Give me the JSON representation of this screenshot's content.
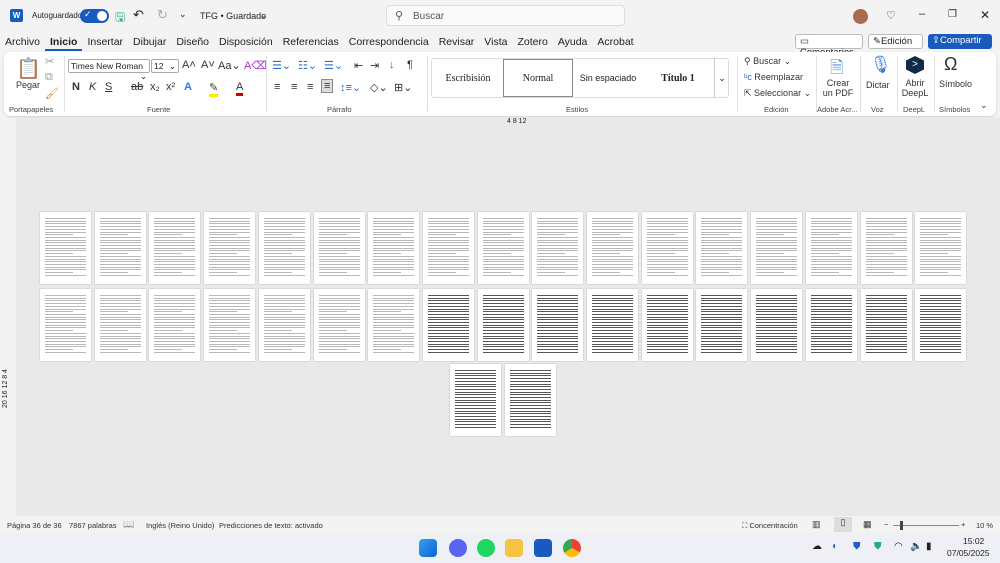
{
  "titlebar": {
    "autosave_label": "Autoguardado",
    "autosave_on": true,
    "doc_title": "TFG • Guardado",
    "search_placeholder": "Buscar"
  },
  "tabs": [
    "Archivo",
    "Inicio",
    "Insertar",
    "Dibujar",
    "Diseño",
    "Disposición",
    "Referencias",
    "Correspondencia",
    "Revisar",
    "Vista",
    "Zotero",
    "Ayuda",
    "Acrobat"
  ],
  "active_tab": "Inicio",
  "header_buttons": {
    "comments": "Comentarios",
    "editing": "Edición",
    "share": "Compartir"
  },
  "ribbon": {
    "clipboard": {
      "paste": "Pegar",
      "group": "Portapapeles"
    },
    "font": {
      "name": "Times New Roman",
      "size": "12",
      "bold": "N",
      "italic": "K",
      "underline": "S",
      "group": "Fuente"
    },
    "paragraph": {
      "group": "Párrafo"
    },
    "styles": {
      "items": [
        "Escribisión",
        "Normal",
        "Sin espaciado",
        "Título 1"
      ],
      "selected": "Normal",
      "group": "Estilos"
    },
    "editing": {
      "find": "Buscar",
      "replace": "Reemplazar",
      "select": "Seleccionar",
      "group": "Edición"
    },
    "adobe": {
      "create_line1": "Crear",
      "create_line2": "un PDF",
      "group": "Adobe Acr..."
    },
    "voice": {
      "dictate": "Dictar",
      "group": "Voz"
    },
    "deepl": {
      "open_line1": "Abrir",
      "open_line2": "DeepL",
      "group": "DeepL"
    },
    "symbols": {
      "symbol": "Símbolo",
      "group": "Símbolos"
    }
  },
  "ruler": {
    "top": "4  8  12",
    "left": "20 16 12 8 4"
  },
  "document": {
    "page_count": 36
  },
  "status": {
    "page": "Página 36 de 36",
    "words": "7867 palabras",
    "language": "Inglés (Reino Unido)",
    "predictions": "Predicciones de texto: activado",
    "focus": "Concentración",
    "zoom": "10 %",
    "zoom_level": 10
  },
  "taskbar": {
    "time": "15:02",
    "date": "07/05/2025",
    "accent": "#185abd"
  }
}
